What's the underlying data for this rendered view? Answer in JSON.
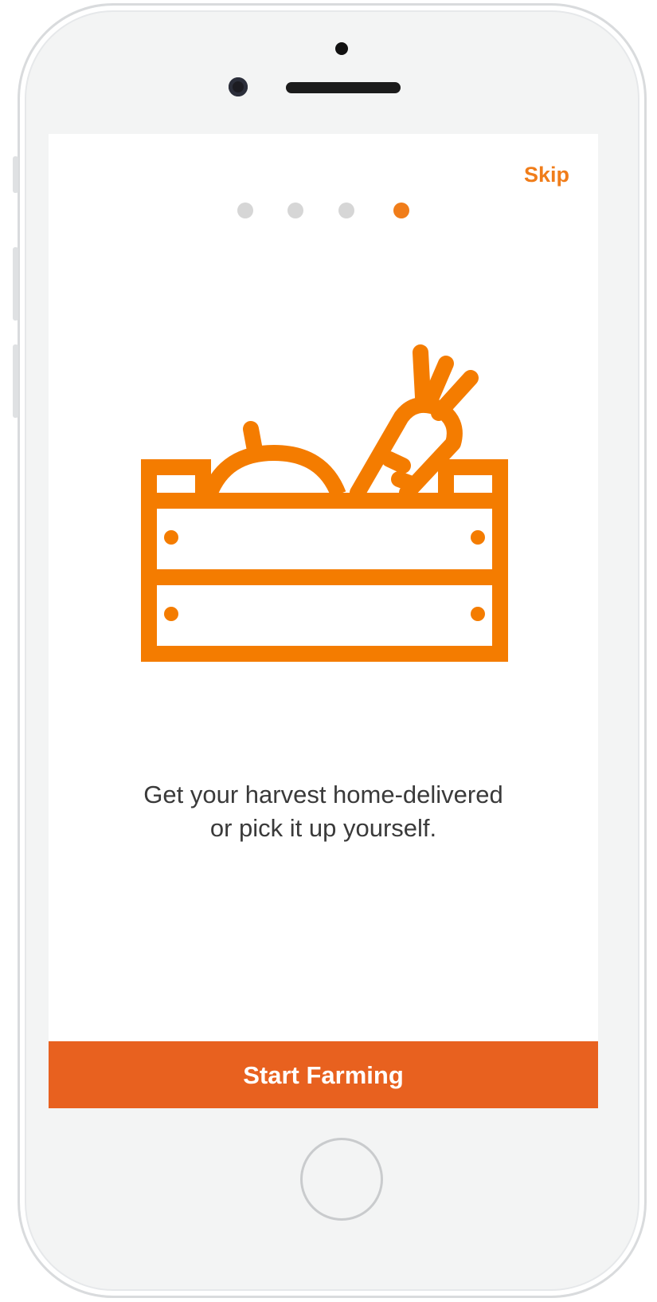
{
  "onboarding": {
    "skip_label": "Skip",
    "page_indicator": {
      "total": 4,
      "active_index": 3
    },
    "illustration_icon": "vegetable-crate-icon",
    "caption_line1": "Get your harvest home-delivered",
    "caption_line2": "or pick it up yourself.",
    "cta_label": "Start Farming"
  },
  "colors": {
    "accent": "#f07d1a",
    "cta_background": "#e8611f",
    "dot_inactive": "#d6d6d6",
    "text": "#3a3a3a"
  }
}
